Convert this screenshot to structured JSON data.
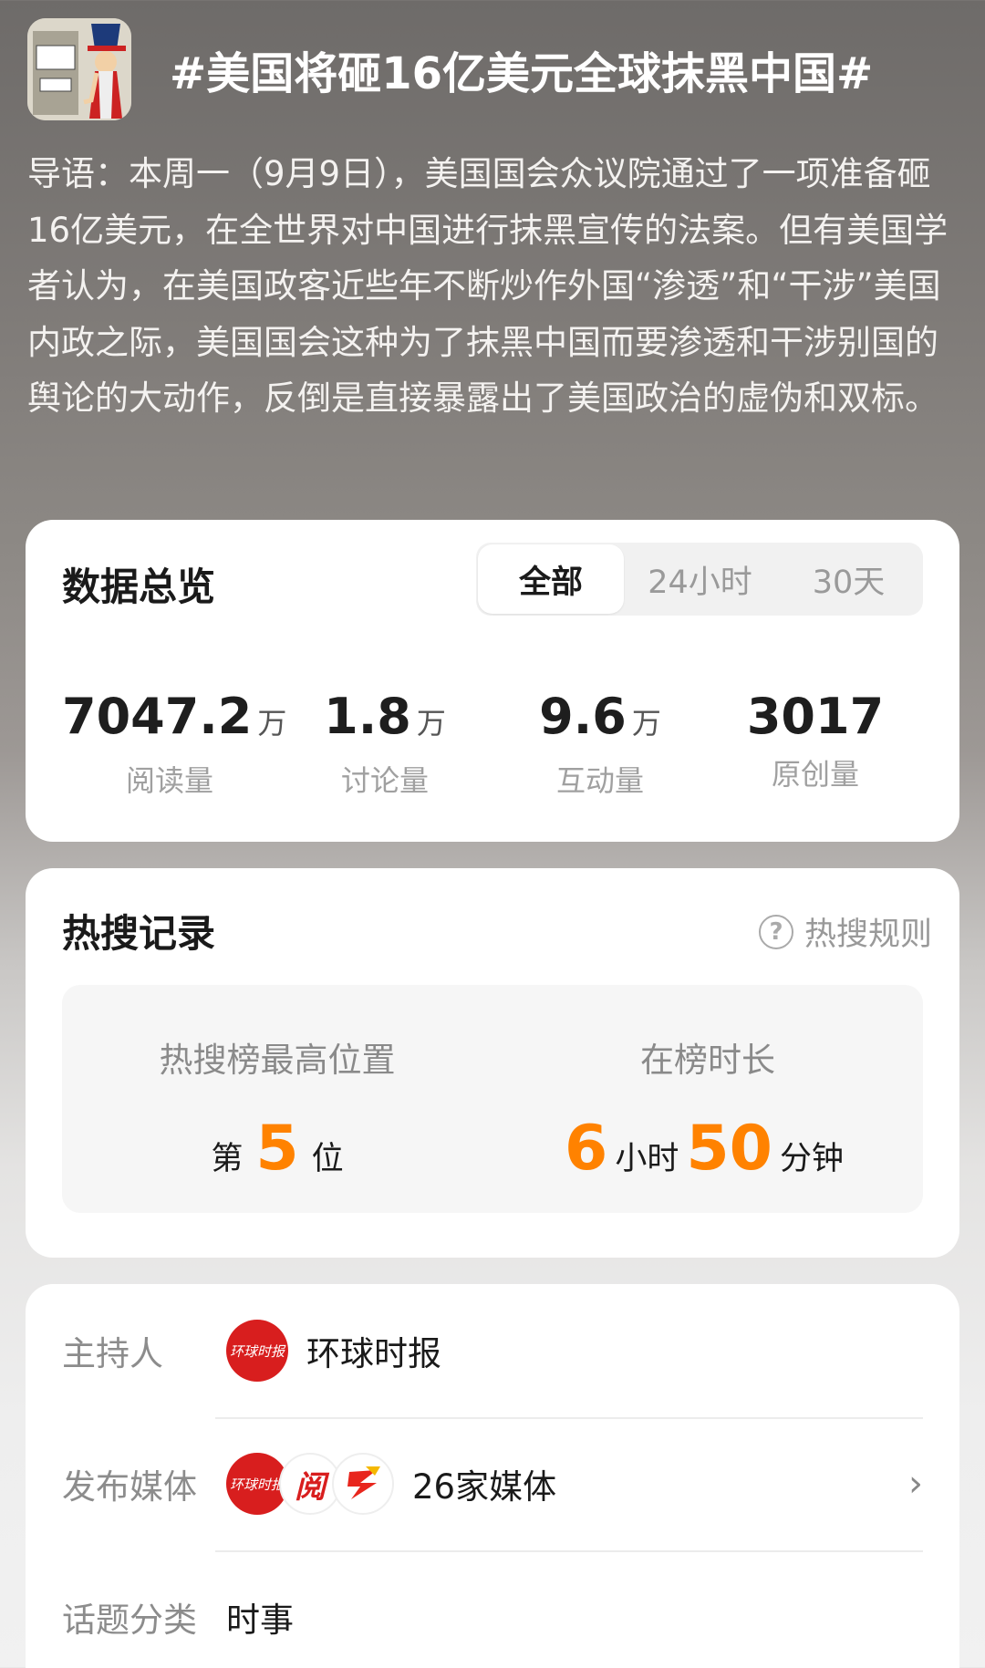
{
  "header": {
    "title": "#美国将砸16亿美元全球抹黑中国#",
    "intro": "导语：本周一（9月9日），美国国会众议院通过了一项准备砸16亿美元，在全世界对中国进行抹黑宣传的法案。但有美国学者认为，在美国政客近些年不断炒作外国“渗透”和“干涉”美国内政之际，美国国会这种为了抹黑中国而要渗透和干涉别国的舆论的大动作，反倒是直接暴露出了美国政治的虚伪和双标。"
  },
  "overview": {
    "title": "数据总览",
    "tabs": [
      "全部",
      "24小时",
      "30天"
    ],
    "stats": [
      {
        "value": "7047.2",
        "unit": "万",
        "label": "阅读量"
      },
      {
        "value": "1.8",
        "unit": "万",
        "label": "讨论量"
      },
      {
        "value": "9.6",
        "unit": "万",
        "label": "互动量"
      },
      {
        "value": "3017",
        "unit": "",
        "label": "原创量"
      }
    ]
  },
  "hot": {
    "title": "热搜记录",
    "rule_label": "热搜规则",
    "best_label": "热搜榜最高位置",
    "best_prefix": "第",
    "best_value": "5",
    "best_suffix": "位",
    "duration_label": "在榜时长",
    "hours": "6",
    "hours_unit": "小时",
    "minutes": "50",
    "minutes_unit": "分钟"
  },
  "info": {
    "host_label": "主持人",
    "host_name": "环球时报",
    "media_label": "发布媒体",
    "media_value": "26家媒体",
    "category_label": "话题分类",
    "category_value": "时事"
  },
  "colors": {
    "accent": "#ff8200",
    "avatar_red": "#d81e1e"
  },
  "icons": [
    "question-icon",
    "chevron-right-icon"
  ]
}
